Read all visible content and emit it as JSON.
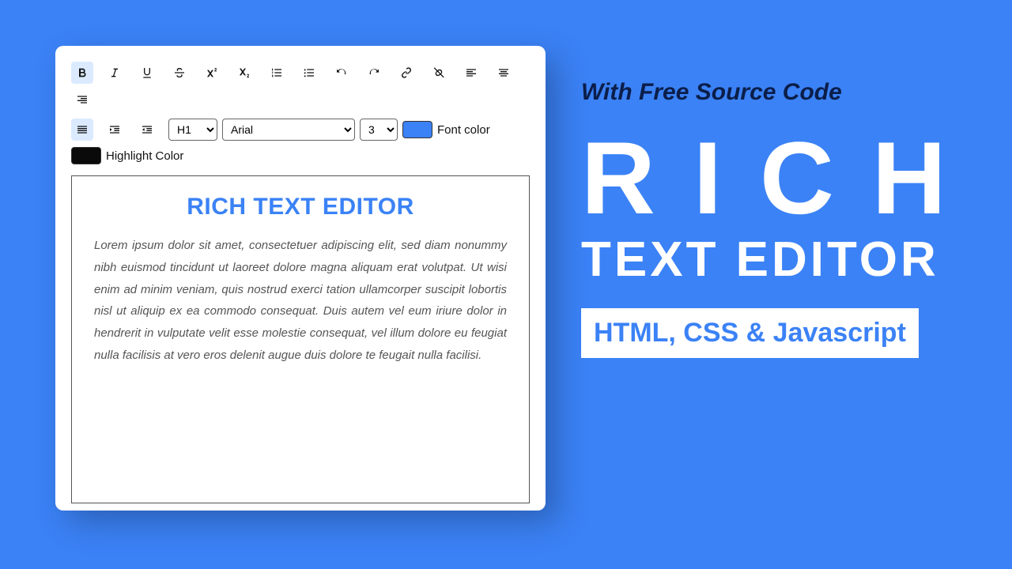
{
  "editor": {
    "toolbar": {
      "heading": "H1",
      "font": "Arial",
      "size": "3",
      "font_color_label": "Font color",
      "highlight_color_label": "Highlight Color"
    },
    "content": {
      "title": "RICH TEXT EDITOR",
      "body": "Lorem ipsum dolor sit amet, consectetuer adipiscing elit, sed diam nonummy nibh euismod tincidunt ut laoreet dolore magna aliquam erat volutpat. Ut wisi enim ad minim veniam, quis nostrud exerci tation ullamcorper suscipit lobortis nisl ut aliquip ex ea commodo consequat. Duis autem vel eum iriure dolor in hendrerit in vulputate velit esse molestie consequat, vel illum dolore eu feugiat nulla facilisis at vero eros delenit augue duis dolore te feugait nulla facilisi."
    }
  },
  "promo": {
    "top": "With Free Source Code",
    "rich": "RICH",
    "sub": "TEXT EDITOR",
    "badge": "HTML, CSS & Javascript"
  },
  "colors": {
    "accent": "#3b82f6"
  }
}
